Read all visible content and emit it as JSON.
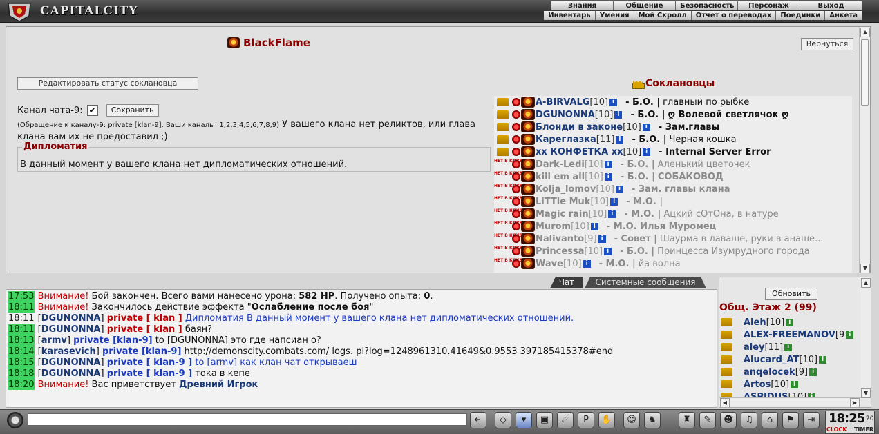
{
  "app": {
    "title": "CAPITALCITY"
  },
  "menu_top": [
    "Знания",
    "Общение",
    "Безопасность",
    "Персонаж",
    "Выход"
  ],
  "menu_bottom": [
    "Инвентарь",
    "Умения",
    "Мой Скролл",
    "Отчет о переводах",
    "Поединки",
    "Анкета"
  ],
  "clan": {
    "name": "BlackFlame"
  },
  "buttons": {
    "back": "Вернуться",
    "edit_status": "Редактировать статус соклановца",
    "save": "Сохранить",
    "refresh": "Обновить"
  },
  "channel": {
    "label": "Канал чата-9:",
    "checked": "✔",
    "note": "(Обращение к каналу-9: private [klan-9]. Ваши каналы: 1,2,3,4,5,6,7,8,9)",
    "relics": "У вашего клана нет реликтов, или глава клана вам их не предоставил ;)"
  },
  "diplomacy": {
    "title": "Дипломатия",
    "text": "В данный момент у вашего клана нет дипломатических отношений."
  },
  "members": {
    "title": "Соклановцы",
    "absent_label": "НЕТ В КЛУБЕ",
    "list": [
      {
        "name": "A-BIRVALG",
        "level": "[10]",
        "rank": "- Б.О. |",
        "motto": "главный по рыбке",
        "online": true,
        "bold_motto": false
      },
      {
        "name": "DGUNONNA",
        "level": "[10]",
        "rank": "- Б.О. |",
        "motto": "ღ Волевой светлячок ღ",
        "online": true,
        "bold_motto": true
      },
      {
        "name": "Блонди в законе",
        "level": "[10]",
        "rank": "- Зам.главы",
        "motto": "",
        "online": true,
        "bold_motto": false
      },
      {
        "name": "Кареглазка",
        "level": "[11]",
        "rank": "- Б.О. |",
        "motto": "Черная кошка",
        "online": true,
        "bold_motto": false
      },
      {
        "name": "xx КОНФЕТКА xx",
        "level": "[10]",
        "rank": "- Internal Server Error",
        "motto": "",
        "online": true,
        "bold_motto": false
      },
      {
        "name": "Dark-Ledi",
        "level": "[10]",
        "rank": "- Б.О. |",
        "motto": "Аленький цветочек",
        "online": false,
        "bold_motto": false
      },
      {
        "name": "kill em all",
        "level": "[10]",
        "rank": "- Б.О. |",
        "motto": "СОБАКОВОД",
        "online": false,
        "bold_motto": true
      },
      {
        "name": "Kolja_lomov",
        "level": "[10]",
        "rank": "- Зам. главы клана",
        "motto": "",
        "online": false,
        "bold_motto": false
      },
      {
        "name": "LiTTle Muk",
        "level": "[10]",
        "rank": "- М.О. |",
        "motto": "",
        "online": false,
        "bold_motto": false
      },
      {
        "name": "Magic rain",
        "level": "[10]",
        "rank": "- М.О. |",
        "motto": "Ацкий сОтОна, в натуре",
        "online": false,
        "bold_motto": false
      },
      {
        "name": "Murom",
        "level": "[10]",
        "rank": "- М.О. Илья Муромец",
        "motto": "",
        "online": false,
        "bold_motto": false
      },
      {
        "name": "Nalivanto",
        "level": "[9]",
        "rank": "- Совет |",
        "motto": "Шаурма в лаваше, руки в анаше...",
        "online": false,
        "bold_motto": false
      },
      {
        "name": "Princessa",
        "level": "[10]",
        "rank": "- Б.О. |",
        "motto": "Принцесса Изумрудного города",
        "online": false,
        "bold_motto": false
      },
      {
        "name": "Wave",
        "level": "[10]",
        "rank": "- М.О. |",
        "motto": "йа волна",
        "online": false,
        "bold_motto": false
      }
    ]
  },
  "chat_tabs": {
    "chat": "Чат",
    "system": "Системные сообщения"
  },
  "chat": [
    {
      "time": "17:53",
      "hl": true,
      "warn": "Внимание!",
      "text": " Бой закончен. Всего вами нанесено урона: ",
      "b1": "582 HP",
      "text2": ". Получено опыта: ",
      "b2": "0",
      "text3": "."
    },
    {
      "time": "18:11",
      "hl": true,
      "warn": "Внимание!",
      "text": " Закончилось действие эффекта \"",
      "b1": "Ослабление после боя",
      "text2": "\""
    },
    {
      "time": "18:11",
      "hl": false,
      "nick": "DGUNONNA",
      "priv": "private [ klan ]",
      "msg": "Дипломатия В данный момент у вашего клана нет дипломатических отношений."
    },
    {
      "time": "18:11",
      "hl": true,
      "nick": "DGUNONNA",
      "priv": "private [ klan ]",
      "msg": "баян?"
    },
    {
      "time": "18:13",
      "hl": true,
      "nick": "armv",
      "privb": "private [klan-9]",
      "msg": "to [DGUNONNA] это где напсиан о?"
    },
    {
      "time": "18:14",
      "hl": true,
      "nick": "karasevich",
      "privb": "private [klan-9]",
      "msg": "http://demonscity.combats.com/ logs. pl?log=1248961310.41649&0.9553 397185415378#end"
    },
    {
      "time": "18:15",
      "hl": true,
      "nick": "DGUNONNA",
      "privb": "private [ klan-9 ]",
      "msg": "to [armv] как клан чат открываеш"
    },
    {
      "time": "18:18",
      "hl": true,
      "nick": "DGUNONNA",
      "privb": "private [ klan-9 ]",
      "msg": "тока в кепе"
    },
    {
      "time": "18:20",
      "hl": true,
      "warn": "Внимание!",
      "text": " Вас приветствует ",
      "nickb": "Древний Игрок"
    }
  ],
  "online": {
    "floor": "Общ. Этаж 2 (99)",
    "users": [
      {
        "name": "Aleh",
        "level": "[10]"
      },
      {
        "name": "ALEX-FREEMANOV",
        "level": "[9"
      },
      {
        "name": "aley",
        "level": "[11]"
      },
      {
        "name": "Alucard_AT",
        "level": "[10]"
      },
      {
        "name": "anqelocek",
        "level": "[9]"
      },
      {
        "name": "Artos",
        "level": "[10]"
      },
      {
        "name": "ASPIDUS",
        "level": "[10]"
      }
    ]
  },
  "clock": {
    "time": "18:25",
    "seconds": "20",
    "label": "CLOCK",
    "timer": "TIMER"
  },
  "colors": {
    "accent": "#8b0000",
    "link": "#1a3a7a",
    "highlight": "#3fd35f"
  }
}
